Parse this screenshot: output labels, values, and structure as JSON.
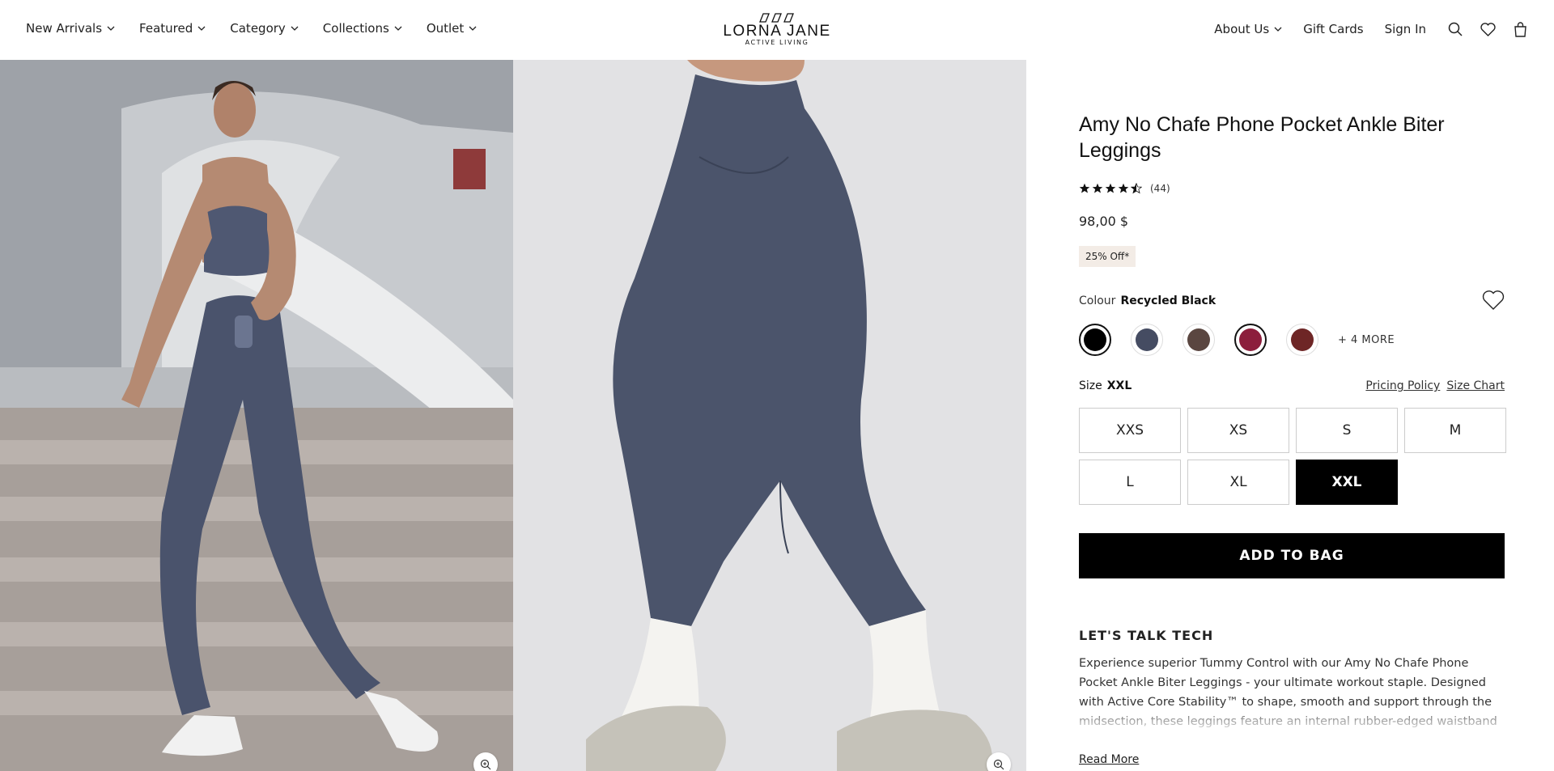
{
  "header": {
    "nav_left": [
      {
        "label": "New Arrivals"
      },
      {
        "label": "Featured"
      },
      {
        "label": "Category"
      },
      {
        "label": "Collections"
      },
      {
        "label": "Outlet"
      }
    ],
    "logo": {
      "brand": "LORNA JANE",
      "tagline": "ACTIVE LIVING"
    },
    "nav_right": [
      {
        "label": "About Us"
      },
      {
        "label": "Gift Cards"
      },
      {
        "label": "Sign In"
      }
    ],
    "icons": [
      "search-icon",
      "heart-icon",
      "bag-icon"
    ]
  },
  "product": {
    "title": "Amy No Chafe Phone Pocket Ankle Biter Leggings",
    "rating": 4.5,
    "rating_count": "(44)",
    "price": "98,00 $",
    "badge": "25% Off*",
    "colour_label": "Colour",
    "colour_value": "Recycled Black",
    "swatches": [
      {
        "color": "#000000",
        "selected": true
      },
      {
        "color": "#454c62",
        "selected": false
      },
      {
        "color": "#5a4640",
        "selected": false
      },
      {
        "color": "#8c1e3c",
        "selected": false
      },
      {
        "color": "#6e2626",
        "selected": false
      }
    ],
    "more_colours": "+ 4 MORE",
    "size_label": "Size",
    "size_value": "XXL",
    "pricing_policy": "Pricing Policy",
    "size_chart": "Size Chart",
    "sizes": [
      "XXS",
      "XS",
      "S",
      "M",
      "L",
      "XL",
      "XXL"
    ],
    "selected_size": "XXL",
    "add_to_bag": "ADD TO BAG",
    "tech_title": "LET'S TALK TECH",
    "tech_body": "Experience superior Tummy Control with our Amy No Chafe Phone Pocket Ankle Biter Leggings - your ultimate workout staple. Designed with Active Core Stability™ to shape, smooth and support through the midsection, these leggings feature an internal rubber-edged waistband and compressive lining for secure core engagement.",
    "read_more": "Read More"
  }
}
